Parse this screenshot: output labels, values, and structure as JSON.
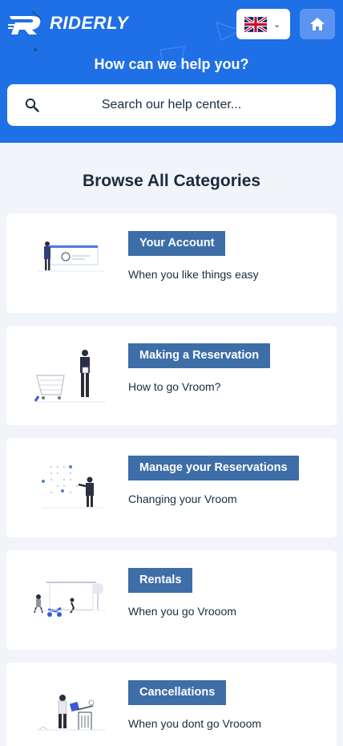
{
  "brand": {
    "name": "RIDERLY"
  },
  "header": {
    "language_flag": "uk-flag-icon",
    "home_icon": "home-icon"
  },
  "hero": {
    "title": "How can we help you?",
    "search_placeholder": "Search our help center..."
  },
  "section": {
    "title": "Browse All Categories"
  },
  "categories": [
    {
      "label": "Your Account",
      "description": "When you like things easy",
      "illustration": "account-illustration"
    },
    {
      "label": "Making a Reservation",
      "description": "How to go Vroom?",
      "illustration": "shopping-cart-illustration"
    },
    {
      "label": "Manage your Reservations",
      "description": "Changing your Vroom",
      "illustration": "schedule-illustration"
    },
    {
      "label": "Rentals",
      "description": "When you go Vrooom",
      "illustration": "scooter-illustration"
    },
    {
      "label": "Cancellations",
      "description": "When you dont go Vrooom",
      "illustration": "trash-illustration"
    }
  ],
  "colors": {
    "hero_blue": "#1f6fe6",
    "badge_blue": "#3d6ea8",
    "home_button": "#5b94f0",
    "page_bg": "#f1f4f9"
  }
}
